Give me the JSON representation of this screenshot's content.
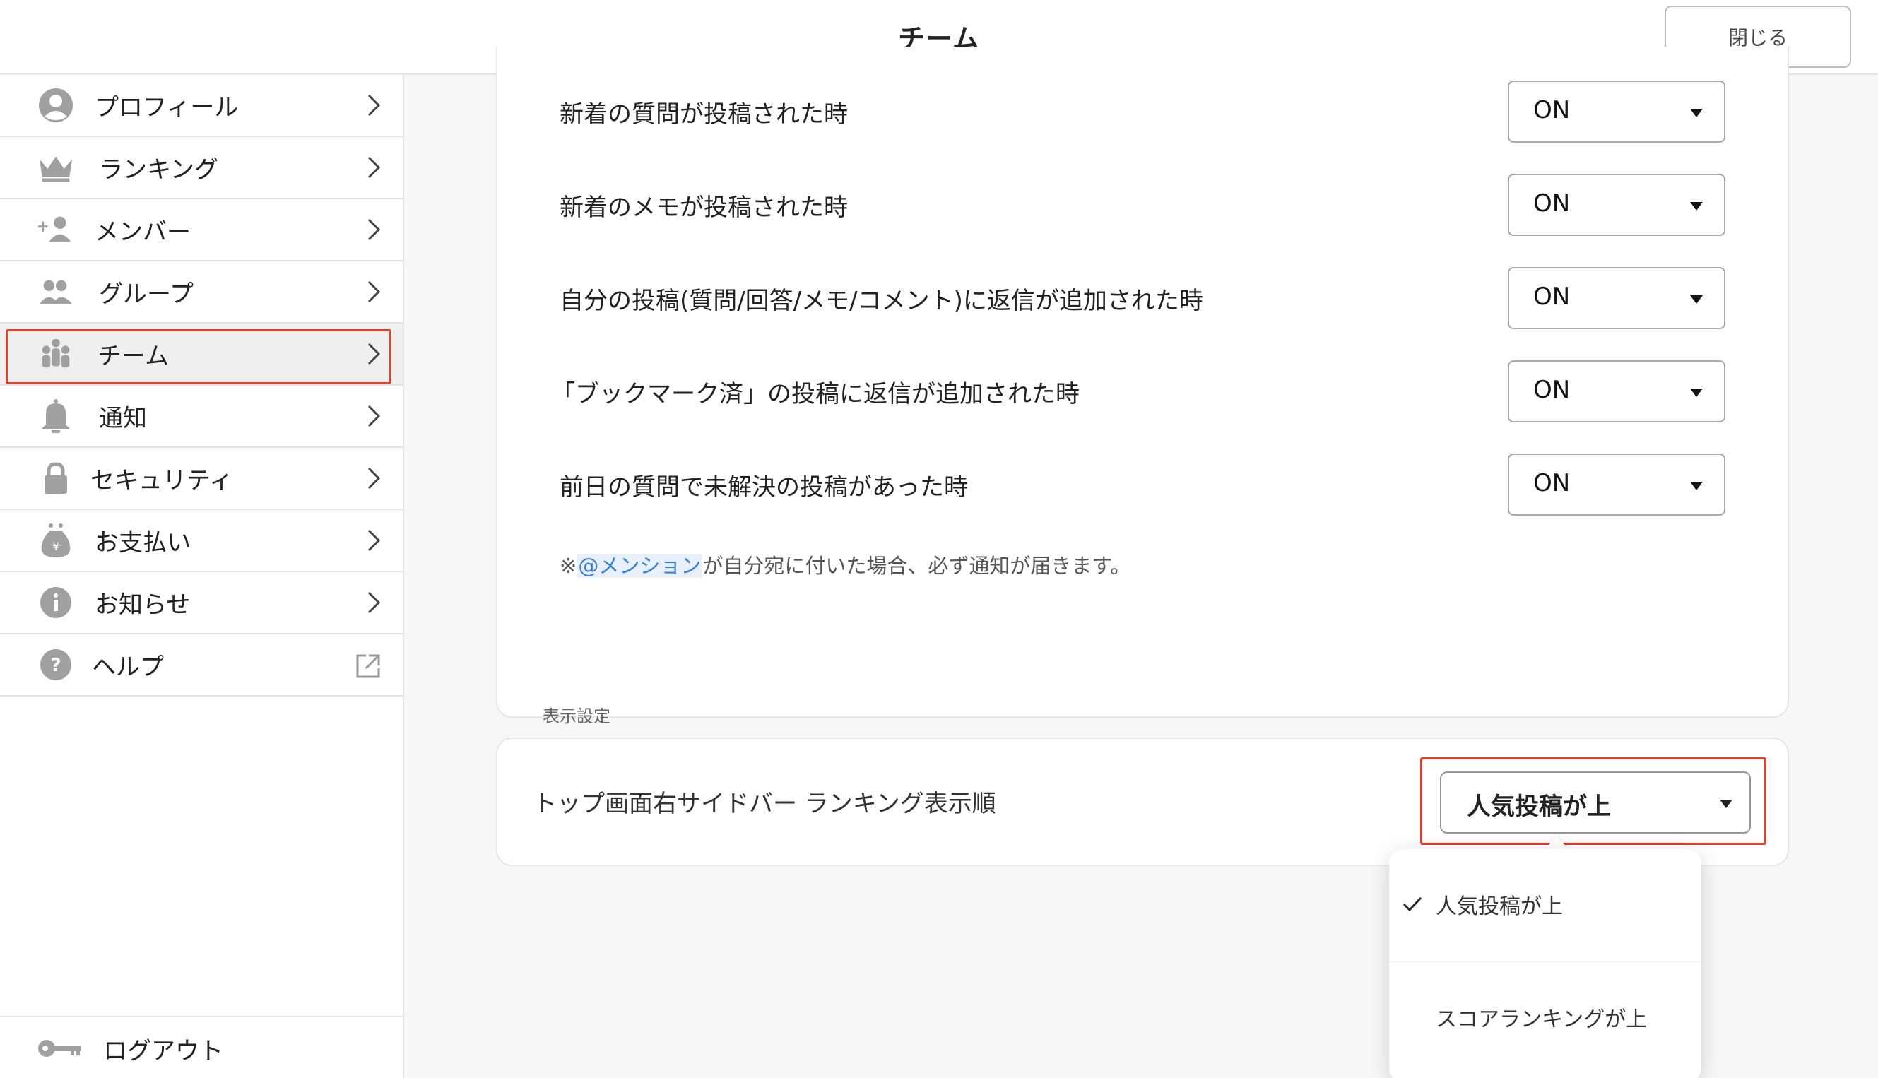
{
  "header": {
    "title": "チーム",
    "close_label": "閉じる"
  },
  "sidebar": {
    "items": [
      {
        "label": "プロフィール",
        "icon": "person-icon"
      },
      {
        "label": "ランキング",
        "icon": "crown-icon"
      },
      {
        "label": "メンバー",
        "icon": "add-person-icon"
      },
      {
        "label": "グループ",
        "icon": "group-icon"
      },
      {
        "label": "チーム",
        "icon": "team-icon",
        "active": true
      },
      {
        "label": "通知",
        "icon": "bell-icon"
      },
      {
        "label": "セキュリティ",
        "icon": "lock-icon"
      },
      {
        "label": "お支払い",
        "icon": "money-bag-icon"
      },
      {
        "label": "お知らせ",
        "icon": "info-icon"
      },
      {
        "label": "ヘルプ",
        "icon": "help-icon",
        "trailing_icon": "external-link-icon"
      }
    ],
    "logout": {
      "label": "ログアウト",
      "icon": "key-icon"
    }
  },
  "notifications": {
    "rows": [
      {
        "label": "新着の質問が投稿された時",
        "value": "ON"
      },
      {
        "label": "新着のメモが投稿された時",
        "value": "ON"
      },
      {
        "label": "自分の投稿(質問/回答/メモ/コメント)に返信が追加された時",
        "value": "ON"
      },
      {
        "label": "「ブックマーク済」の投稿に返信が追加された時",
        "value": "ON"
      },
      {
        "label": "前日の質問で未解決の投稿があった時",
        "value": "ON"
      }
    ],
    "note_prefix": "※",
    "note_mention": "@メンション",
    "note_suffix": "が自分宛に付いた場合、必ず通知が届きます。"
  },
  "display_settings": {
    "section_label": "表示設定",
    "ranking_order_label": "トップ画面右サイドバー ランキング表示順",
    "selected": "人気投稿が上",
    "options": [
      {
        "label": "人気投稿が上",
        "checked": true
      },
      {
        "label": "スコアランキングが上",
        "checked": false
      }
    ]
  },
  "colors": {
    "highlight": "#e0412f",
    "mention": "#3a7fd0",
    "icon": "#9a9a9a"
  }
}
